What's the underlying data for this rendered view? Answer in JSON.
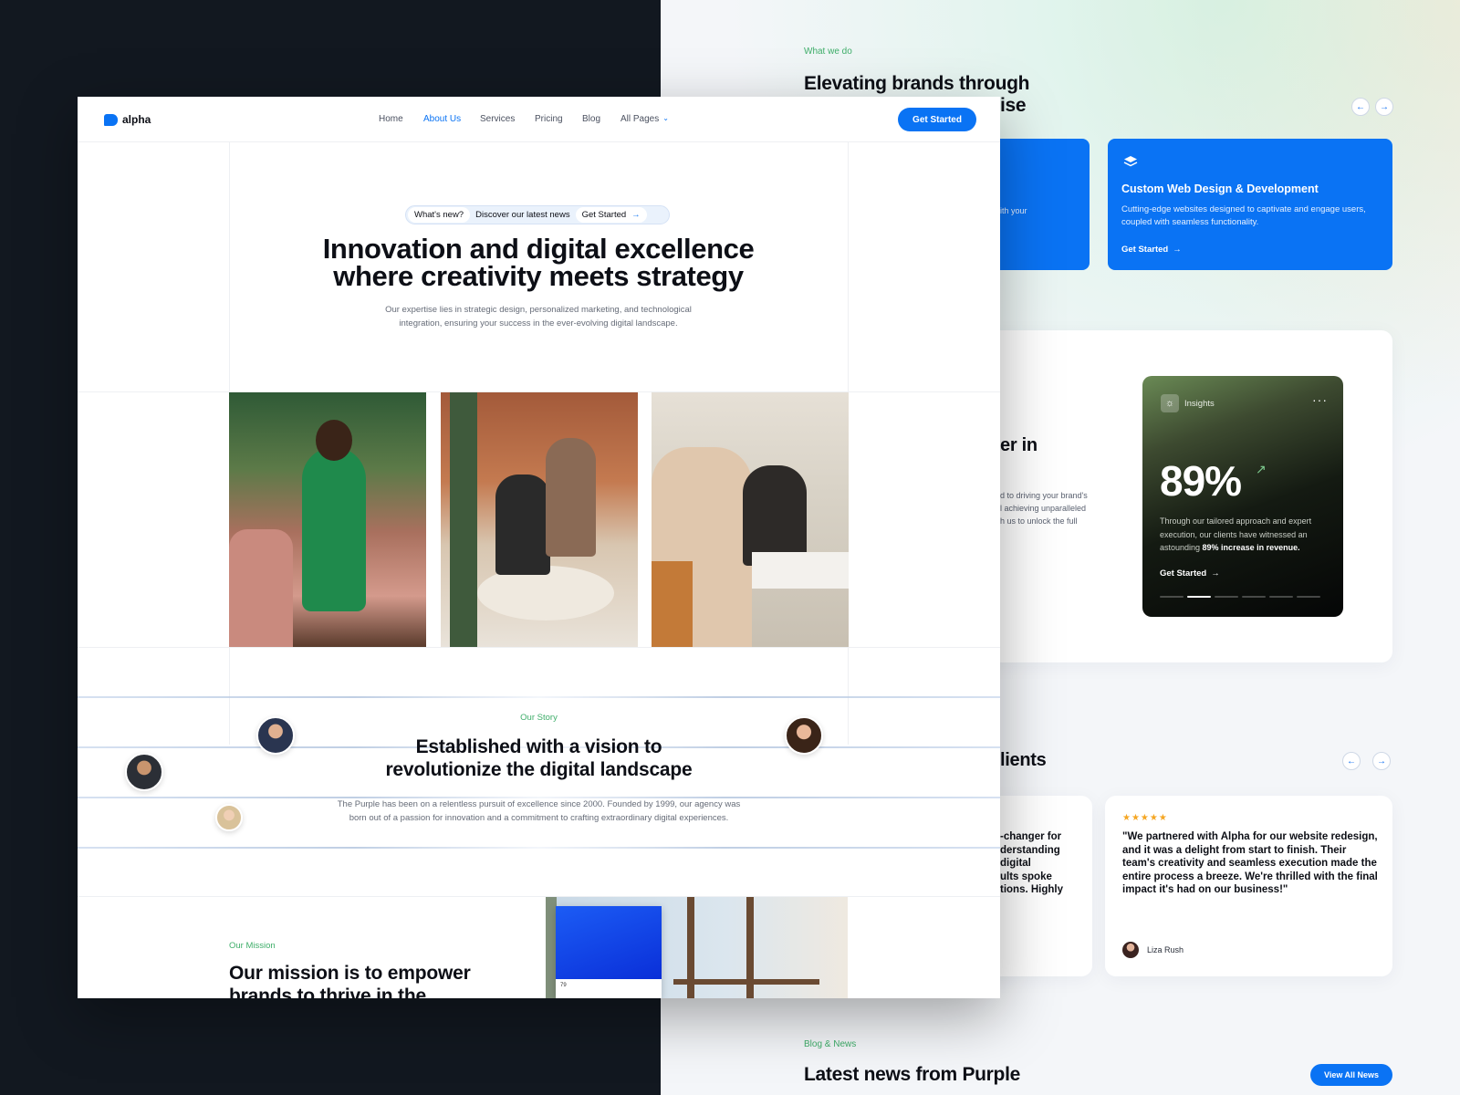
{
  "right": {
    "what_eyebrow": "What we do",
    "what_title_line1": "Elevating brands through",
    "what_title_line2": "ise",
    "card1_partial": "ith your",
    "card2_title": "Custom Web Design & Development",
    "card2_desc": "Cutting-edge websites designed to captivate and engage users, coupled with seamless functionality.",
    "card2_link": "Get Started",
    "section2_partial_title": "er in",
    "section2_partial_text": [
      "d to driving your brand's",
      "l achieving unparalleled",
      "h us to unlock the full"
    ],
    "insights": {
      "label": "Insights",
      "percent": "89%",
      "desc_pre": "Through our tailored approach and expert execution, our clients have witnessed an astounding ",
      "desc_bold": "89% increase in revenue.",
      "link": "Get Started",
      "active_dot": 1
    },
    "clients_partial_title": "lients",
    "testimonial_partial": [
      "-changer for",
      "derstanding",
      "digital",
      "ults spoke",
      "tions. Highly"
    ],
    "testimonial": {
      "stars": "★★★★★",
      "quote": "\"We partnered with Alpha for our website redesign, and it was a delight from start to finish. Their team's creativity and seamless execution made the entire process a breeze. We're thrilled with the final impact it's had on our business!\"",
      "author": "Liza Rush"
    },
    "blog_eyebrow": "Blog & News",
    "blog_title": "Latest news from Purple",
    "view_all": "View All News"
  },
  "front": {
    "logo": "alpha",
    "nav": [
      "Home",
      "About Us",
      "Services",
      "Pricing",
      "Blog",
      "All Pages"
    ],
    "active_nav": "About Us",
    "cta": "Get Started",
    "badge": {
      "new": "What's new?",
      "text": "Discover our latest news",
      "link": "Get Started"
    },
    "hero_line1": "Innovation and digital excellence",
    "hero_line2": "where creativity meets strategy",
    "hero_sub_line1": "Our expertise lies in strategic design, personalized marketing, and technological",
    "hero_sub_line2": "integration, ensuring your success in the ever-evolving digital landscape.",
    "story_eyebrow": "Our Story",
    "story_line1": "Established with a vision to",
    "story_line2": "revolutionize the digital landscape",
    "story_desc_line1": "The Purple has been on a relentless pursuit of excellence since 2000. Founded by 1999, our agency was",
    "story_desc_line2": "born out of a passion for innovation and a commitment to crafting extraordinary digital experiences.",
    "mission_eyebrow": "Our Mission",
    "mission_line1": "Our mission is to empower",
    "mission_line2": "brands to thrive in the",
    "mini_card_value": "79"
  },
  "colors": {
    "accent": "#0a73f4",
    "green": "#3fae6a",
    "dark": "#121820"
  }
}
